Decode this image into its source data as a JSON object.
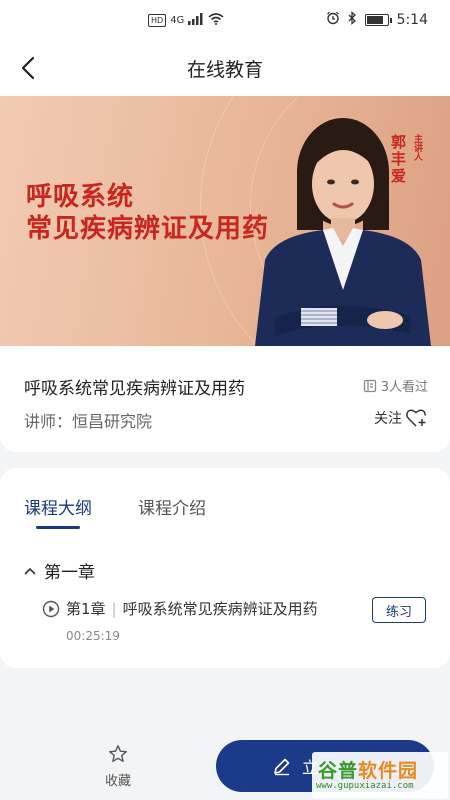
{
  "status_bar": {
    "network_badge": "HD",
    "network_type": "4G",
    "time": "5:14",
    "battery_level": 0.85
  },
  "nav": {
    "title": "在线教育",
    "back_icon": "chevron-left-icon"
  },
  "banner": {
    "title_line1": "呼吸系统",
    "title_line2": "常见疾病辨证及用药",
    "speaker_role": "主讲人",
    "speaker_name": "郭丰爱"
  },
  "course": {
    "title": "呼吸系统常见疾病辨证及用药",
    "viewers": "3人看过",
    "lecturer": "讲师：恒昌研究院",
    "follow_label": "关注"
  },
  "tabs": [
    {
      "label": "课程大纲",
      "active": true
    },
    {
      "label": "课程介绍",
      "active": false
    }
  ],
  "outline": {
    "chapter_title": "第一章",
    "lessons": [
      {
        "chapter": "第1章",
        "title": "呼吸系统常见疾病辨证及用药",
        "duration": "00:25:19",
        "action": "练习"
      }
    ]
  },
  "bottom_bar": {
    "collect_label": "收藏",
    "primary_label": "立"
  },
  "watermark": {
    "brand_green": "谷普",
    "brand_orange": "软件园",
    "url": "www.gupuxiazai.com"
  },
  "colors": {
    "accent": "#1b3a7a",
    "banner_title": "#c8261e",
    "primary_button": "#1b3a8a"
  }
}
